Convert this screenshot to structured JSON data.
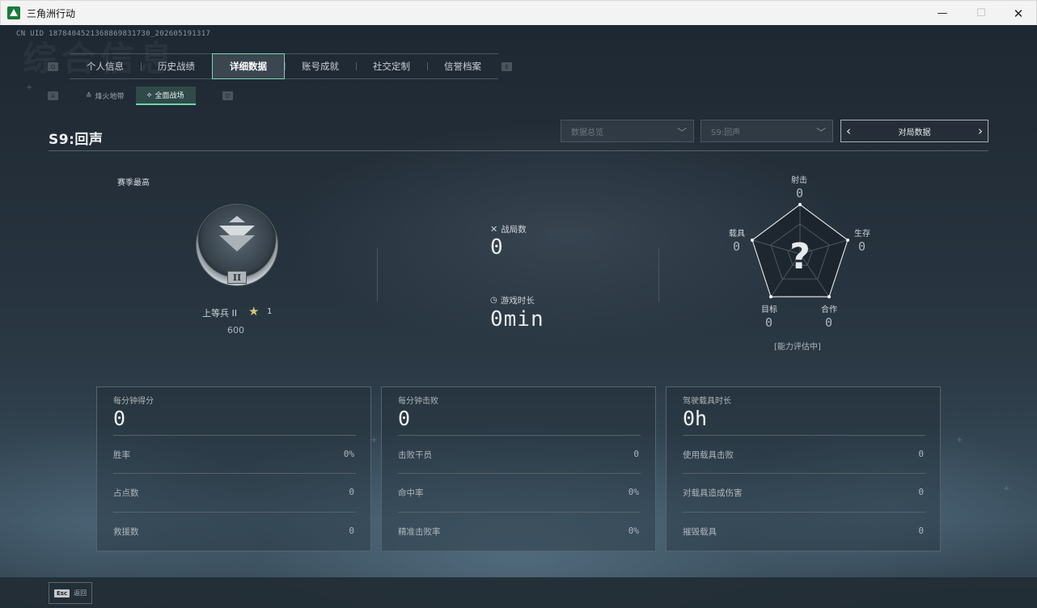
{
  "window": {
    "title": "三角洲行动",
    "icon": "delta-logo-icon",
    "controls": [
      "minimize-icon",
      "maximize-icon",
      "close-icon"
    ]
  },
  "header": {
    "uid": "CN UID 1878404521368869831730_202605191317",
    "watermark_title": "综合信息"
  },
  "tabs": {
    "left_hint": "Q",
    "right_hint": "E",
    "items": [
      {
        "label": "个人信息",
        "active": false
      },
      {
        "label": "历史战绩",
        "active": false
      },
      {
        "label": "详细数据",
        "active": true
      },
      {
        "label": "账号成就",
        "active": false
      },
      {
        "label": "社交定制",
        "active": false
      },
      {
        "label": "信誉档案",
        "active": false
      }
    ]
  },
  "subtabs": {
    "left_hint": "A",
    "right_hint": "D",
    "items": [
      {
        "label": "烽火地带",
        "icon": "flame-zone-icon",
        "active": false
      },
      {
        "label": "全面战场",
        "icon": "battlefield-icon",
        "active": true
      }
    ]
  },
  "season": {
    "title": "S9:回声"
  },
  "filters": {
    "data_type": "数据总览",
    "season": "S9:回声",
    "pager_label": "对局数据"
  },
  "rank": {
    "section_label": "赛季最高",
    "name": "上等兵 II",
    "tier_roman": "II",
    "stars": "1",
    "score": "600"
  },
  "stats": {
    "matches_label": "战局数",
    "matches_value": "0",
    "playtime_label": "游戏时长",
    "playtime_value": "0min"
  },
  "radar": {
    "labels": {
      "shooting": "射击",
      "survival": "生存",
      "teamwork": "合作",
      "objective": "目标",
      "vehicle": "载具"
    },
    "values": {
      "shooting": "0",
      "survival": "0",
      "teamwork": "0",
      "objective": "0",
      "vehicle": "0"
    },
    "placeholder": "?",
    "assessing": "[能力评估中]"
  },
  "cards": [
    {
      "title": "每分钟得分",
      "value": "0",
      "rows": [
        {
          "label": "胜率",
          "value": "0%"
        },
        {
          "label": "占点数",
          "value": "0"
        },
        {
          "label": "救援数",
          "value": "0"
        }
      ]
    },
    {
      "title": "每分钟击败",
      "value": "0",
      "rows": [
        {
          "label": "击败干员",
          "value": "0"
        },
        {
          "label": "命中率",
          "value": "0%"
        },
        {
          "label": "精准击败率",
          "value": "0%"
        }
      ]
    },
    {
      "title": "驾驶载具时长",
      "value": "0h",
      "rows": [
        {
          "label": "使用载具击败",
          "value": "0"
        },
        {
          "label": "对载具造成伤害",
          "value": "0"
        },
        {
          "label": "摧毁载具",
          "value": "0"
        }
      ]
    }
  ],
  "footer": {
    "esc_key": "Esc",
    "esc_label": "返回"
  }
}
